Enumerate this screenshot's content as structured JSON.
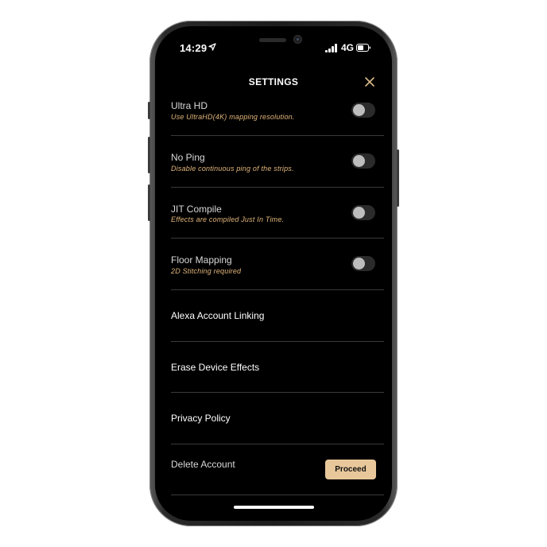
{
  "status_bar": {
    "time": "14:29",
    "network": "4G"
  },
  "header": {
    "title": "SETTINGS"
  },
  "toggles": [
    {
      "title": "Ultra HD",
      "description": "Use UltraHD(4K) mapping resolution.",
      "enabled": false
    },
    {
      "title": "No Ping",
      "description": "Disable continuous ping of the strips.",
      "enabled": false
    },
    {
      "title": "JIT Compile",
      "description": "Effects are compiled Just In Time.",
      "enabled": false
    },
    {
      "title": "Floor Mapping",
      "description": "2D Stitching required",
      "enabled": false
    }
  ],
  "links": [
    {
      "title": "Alexa Account Linking"
    },
    {
      "title": "Erase Device Effects"
    },
    {
      "title": "Privacy Policy"
    }
  ],
  "delete_account": {
    "title": "Delete Account",
    "button_label": "Proceed"
  },
  "colors": {
    "accent_text": "#e2b57a",
    "button_bg": "#e8c89b",
    "background": "#000000"
  }
}
